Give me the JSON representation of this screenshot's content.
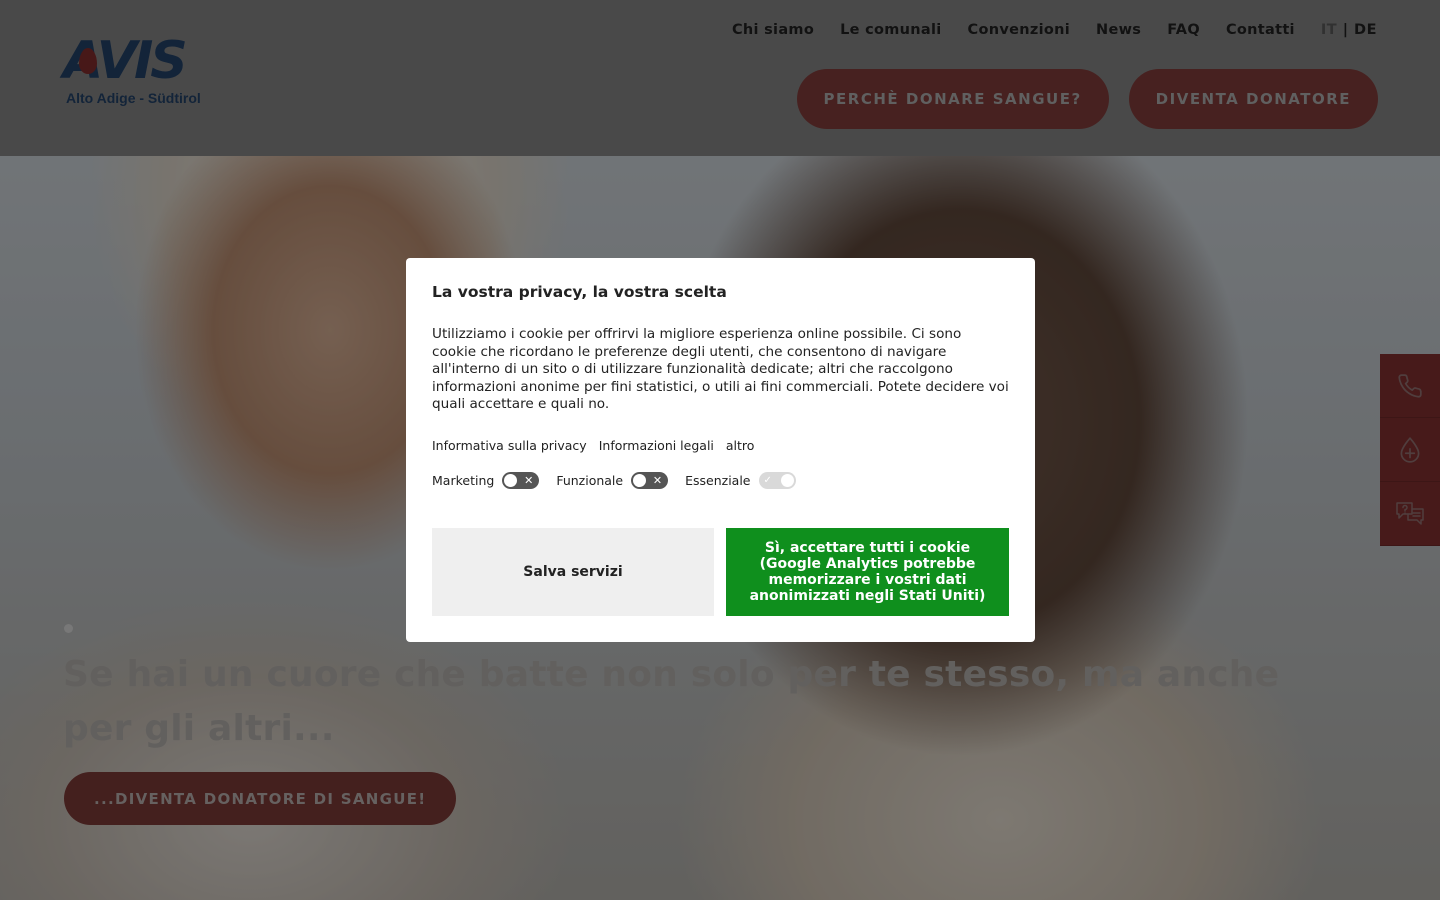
{
  "header": {
    "logo": {
      "wordmark": "AVIS",
      "subtitle": "Alto Adige - Südtirol"
    },
    "nav": [
      "Chi siamo",
      "Le comunali",
      "Convenzioni",
      "News",
      "FAQ",
      "Contatti"
    ],
    "lang": {
      "active": "IT",
      "separator": "|",
      "other": "DE"
    },
    "cta": {
      "why_donate": "PERCHÈ DONARE SANGUE?",
      "become_donor": "DIVENTA DONATORE"
    }
  },
  "side_tabs": [
    "phone-icon",
    "blood-drop-plus-icon",
    "faq-chat-icon"
  ],
  "hero": {
    "title": "Se hai un cuore che batte non solo per te stesso, ma anche per gli altri...",
    "button": "...DIVENTA DONATORE DI SANGUE!"
  },
  "cookie_modal": {
    "title": "La vostra privacy, la vostra scelta",
    "text": "Utilizziamo i cookie per offrirvi la migliore esperienza online possibile. Ci sono cookie che ricordano le preferenze degli utenti, che consentono di navigare all'interno di un sito o di utilizzare funzionalità dedicate; altri che raccolgono informazioni anonime per fini statistici, o utili ai fini commerciali. Potete decidere voi quali accettare e quali no.",
    "links": [
      "Informativa sulla privacy",
      "Informazioni legali",
      "altro"
    ],
    "toggles": [
      {
        "label": "Marketing",
        "state": "off"
      },
      {
        "label": "Funzionale",
        "state": "off"
      },
      {
        "label": "Essenziale",
        "state": "locked-on"
      }
    ],
    "save_button": "Salva servizi",
    "accept_button": "Sì, accettare tutti i cookie (Google Analytics potrebbe memorizzare i vostri dati anonimizzati negli Stati Uniti)"
  },
  "colors": {
    "brand_red": "#b3261e",
    "brand_blue": "#1d4f8c",
    "accept_green": "#0f8f1d"
  }
}
